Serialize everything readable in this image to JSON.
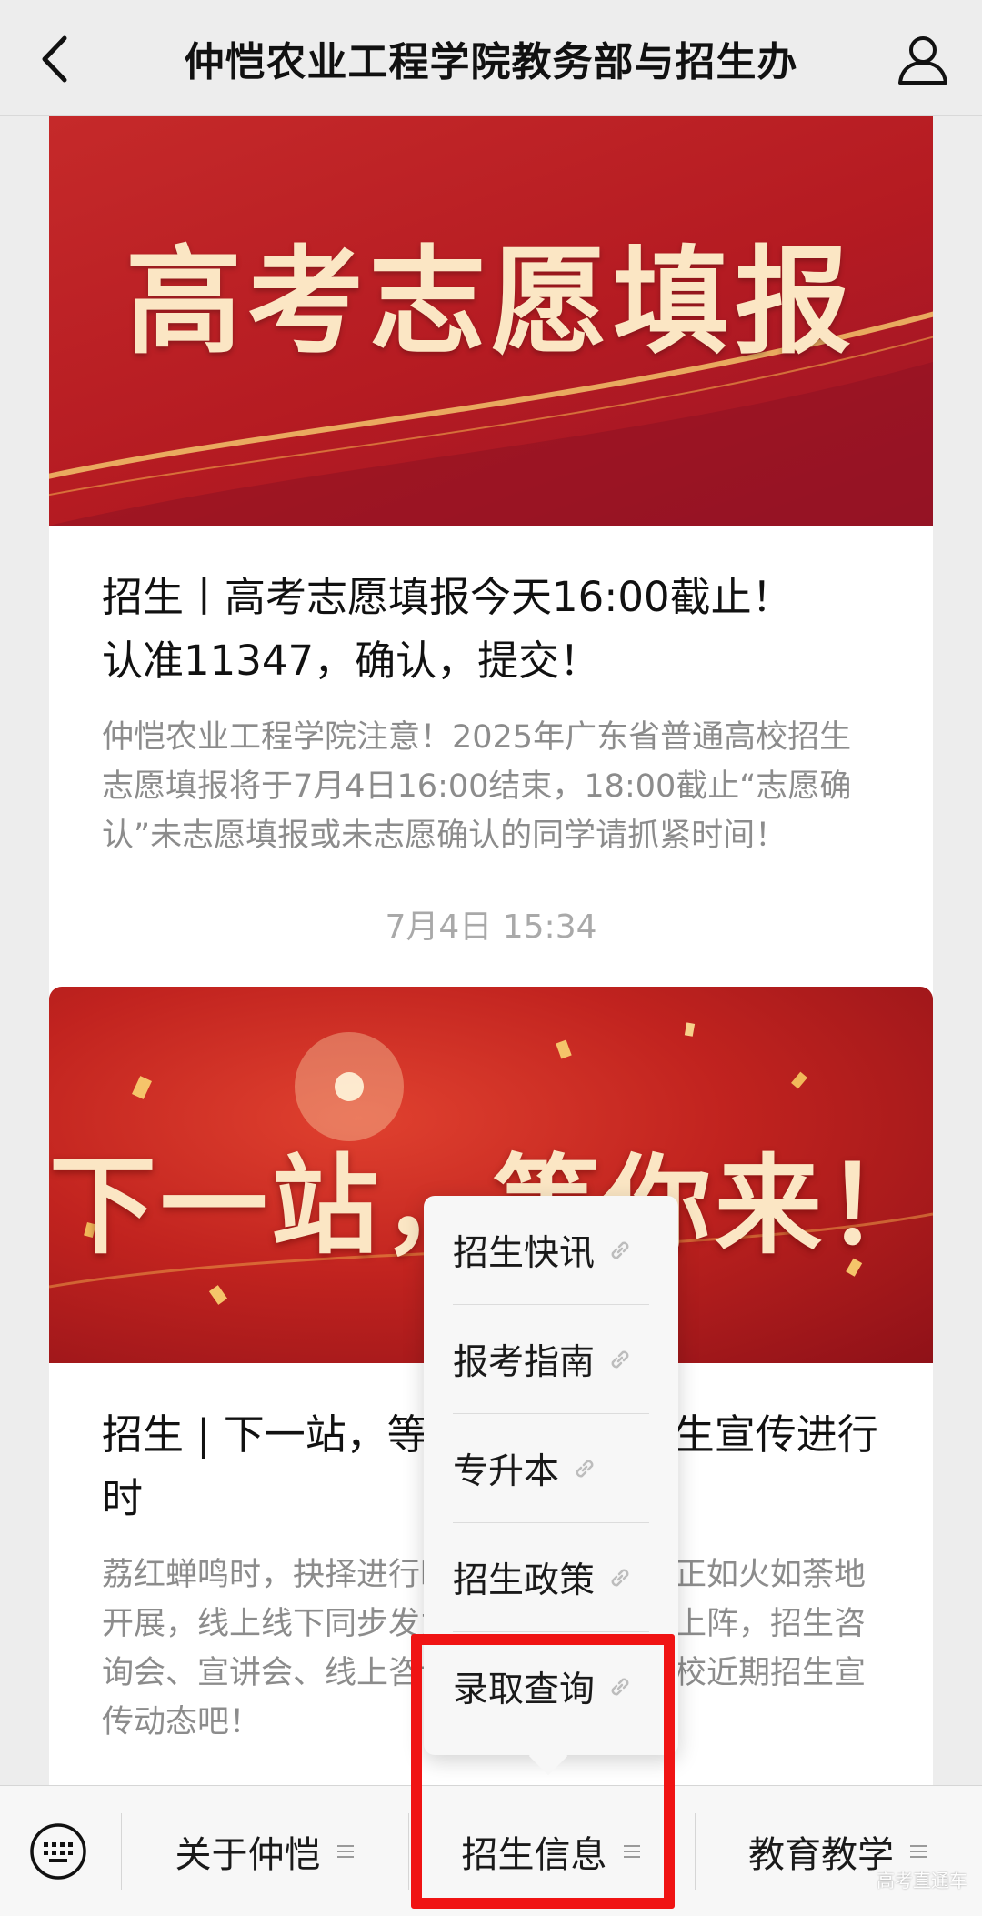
{
  "header": {
    "title": "仲恺农业工程学院教务部与招生办",
    "back_icon": "chevron-left-icon",
    "profile_icon": "person-icon"
  },
  "articles": [
    {
      "banner_text": "高考志愿填报",
      "title_line1": "招生丨高考志愿填报今天16:00截止！",
      "title_line2": "认准11347，确认，提交！",
      "summary": "仲恺农业工程学院注意！2025年广东省普通高校招生志愿填报将于7月4日16:00结束，18:00截止“志愿确认”未志愿填报或未志愿确认的同学请抓紧时间！"
    },
    {
      "banner_text": "下一站，等你来！",
      "title": "招生 | 下一站，等你来！仲恺招生宣传进行时",
      "summary": "荔红蝉鸣时，抉择进行时。仲恺招生宣传正如火如荼地开展，线上线下同步发力，老师同学们齐上阵，招生咨询会、宣讲会、线上咨询……快来看看学校近期招生宣传动态吧！"
    }
  ],
  "timestamp": "7月4日 15:34",
  "popup_menu": {
    "items": [
      {
        "label": "招生快讯",
        "icon": "link-icon"
      },
      {
        "label": "报考指南",
        "icon": "link-icon"
      },
      {
        "label": "专升本",
        "icon": "link-icon"
      },
      {
        "label": "招生政策",
        "icon": "link-icon"
      },
      {
        "label": "录取查询",
        "icon": "link-icon"
      }
    ]
  },
  "bottom_bar": {
    "keyboard_icon": "keyboard-icon",
    "tabs": [
      {
        "label": "关于仲恺",
        "icon": "menu-lines-icon"
      },
      {
        "label": "招生信息",
        "icon": "menu-lines-icon"
      },
      {
        "label": "教育教学",
        "icon": "menu-lines-icon"
      }
    ]
  },
  "watermark": "高考直通车",
  "colors": {
    "banner_red": "#c1231f",
    "banner_gold_text": "#fbe6c4",
    "highlight_box": "#f01414",
    "background": "#ededed"
  }
}
